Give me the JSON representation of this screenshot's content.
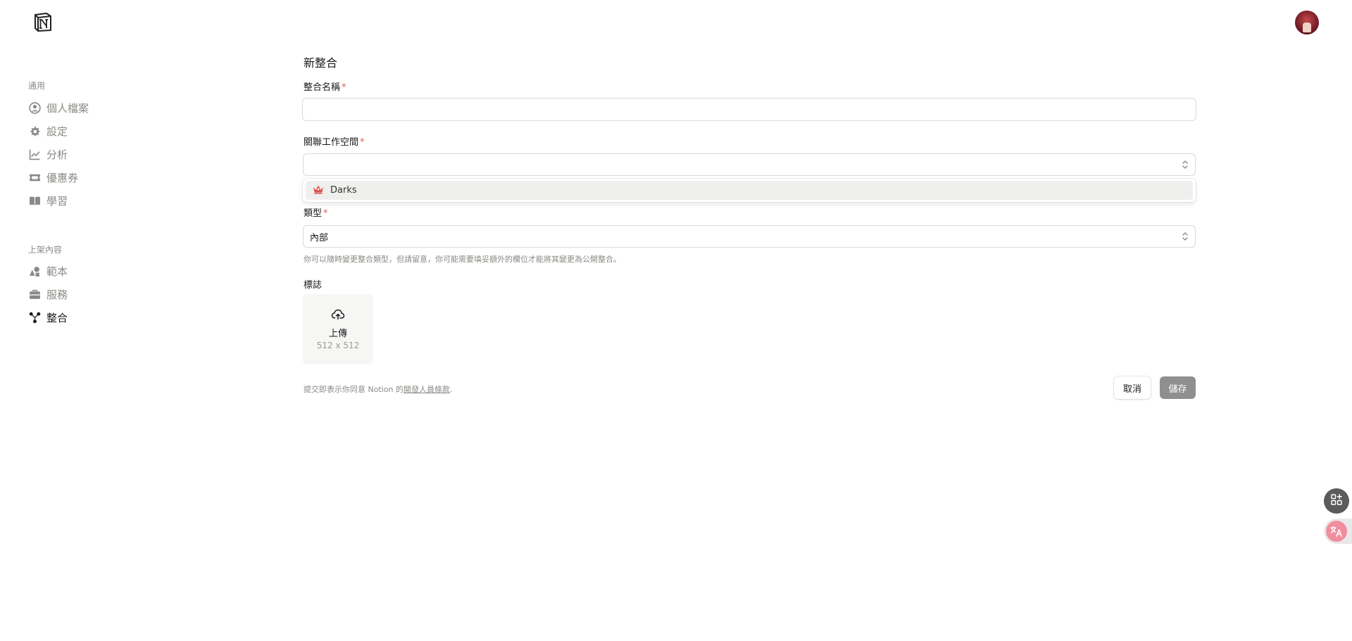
{
  "sidebar": {
    "section_general": "通用",
    "general_items": [
      {
        "label": "個人檔案",
        "icon": "profile-icon"
      },
      {
        "label": "設定",
        "icon": "gear-icon"
      },
      {
        "label": "分析",
        "icon": "analytics-icon"
      },
      {
        "label": "優惠券",
        "icon": "coupon-icon"
      },
      {
        "label": "學習",
        "icon": "book-icon"
      }
    ],
    "section_listings": "上架內容",
    "listing_items": [
      {
        "label": "範本",
        "icon": "shapes-icon"
      },
      {
        "label": "服務",
        "icon": "briefcase-icon"
      },
      {
        "label": "整合",
        "icon": "integration-icon",
        "active": true
      }
    ]
  },
  "form": {
    "title": "新整合",
    "name_label": "整合名稱",
    "name_value": "",
    "workspace_label": "關聯工作空間",
    "workspace_value": "",
    "workspace_options": [
      {
        "label": "Darks",
        "icon": "crown-icon"
      }
    ],
    "type_label": "類型",
    "type_value": "內部",
    "type_hint": "你可以隨時變更整合類型，但請留意，你可能需要填妥額外的欄位才能將其變更為公開整合。",
    "logo_label": "標誌",
    "upload_label": "上傳",
    "upload_size": "512 x 512",
    "terms_prefix": "提交即表示你同意 Notion 的",
    "terms_link": "開發人員條款",
    "terms_suffix": ".",
    "required_mark": "*",
    "cancel_label": "取消",
    "save_label": "儲存"
  },
  "colors": {
    "required": "#eb5757",
    "save_button": "#8f8f8f",
    "crown": "#d9534f"
  }
}
